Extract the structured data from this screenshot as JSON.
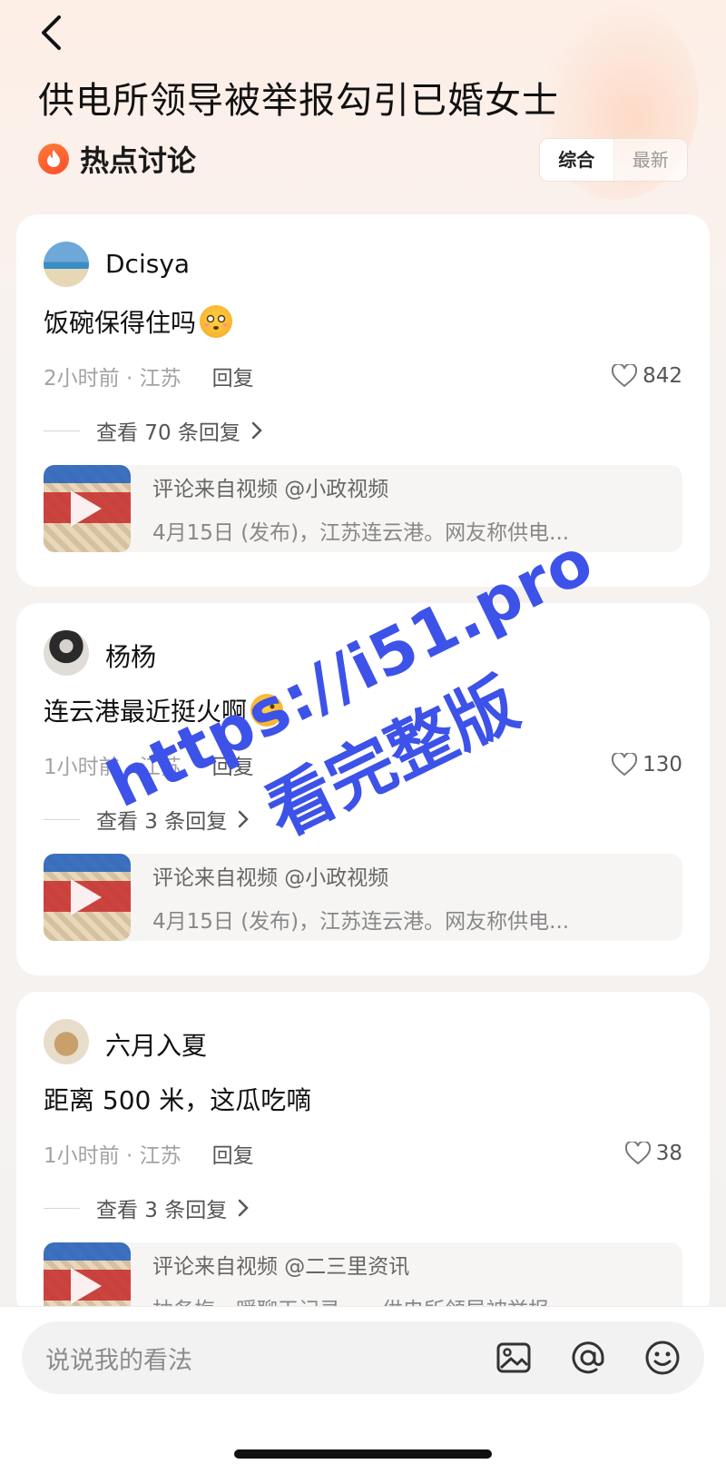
{
  "header": {
    "title": "供电所领导被举报勾引已婚女士",
    "section_title": "热点讨论",
    "sort_options": [
      "综合",
      "最新"
    ]
  },
  "comments": [
    {
      "username": "Dcisya",
      "text": "饭碗保得住吗",
      "time_location": "2小时前 · 江苏",
      "reply_label": "回复",
      "likes": "842",
      "view_replies": "查看 70 条回复",
      "source_line1": "评论来自视频 @小政视频",
      "source_line2": "4月15日 (发布)，江苏连云港。网友称供电..."
    },
    {
      "username": "杨杨",
      "text": "连云港最近挺火啊",
      "time_location": "1小时前 · 江苏",
      "reply_label": "回复",
      "likes": "130",
      "view_replies": "查看 3 条回复",
      "source_line1": "评论来自视频 @小政视频",
      "source_line2": "4月15日 (发布)，江苏连云港。网友称供电..."
    },
    {
      "username": "六月入夏",
      "text": "距离 500 米，这瓜吃嘀",
      "time_location": "1小时前 · 江苏",
      "reply_label": "回复",
      "likes": "38",
      "view_replies": "查看 3 条回复",
      "source_line1": "评论来自视频 @二三里资讯",
      "source_line2": "柚务梅，暖聊天记录……供电所领导被举报"
    }
  ],
  "watermark": {
    "line1": "https://i51.pro",
    "line2": "看完整版"
  },
  "input": {
    "placeholder": "说说我的看法"
  },
  "colors": {
    "accent_orange": "#ff5a2e",
    "watermark_blue": "#3d52e8"
  }
}
